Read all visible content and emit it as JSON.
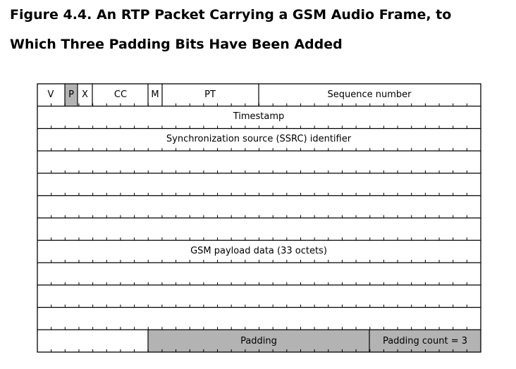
{
  "caption": {
    "line1": "Figure 4.4. An RTP Packet Carrying a GSM Audio Frame, to",
    "line2": "Which Three Padding Bits Have Been Added"
  },
  "diagram": {
    "header_row": {
      "version": "V",
      "padding_flag": "P",
      "extension_flag": "X",
      "csrc_count": "CC",
      "marker": "M",
      "payload_type": "PT",
      "sequence_number": "Sequence number"
    },
    "timestamp": "Timestamp",
    "ssrc": "Synchronization source (SSRC) identifier",
    "payload": "GSM payload data (33 octets)",
    "padding": "Padding",
    "padding_count": "Padding count = 3",
    "colors": {
      "line": "#000000",
      "shaded": "#b3b3b3"
    }
  }
}
